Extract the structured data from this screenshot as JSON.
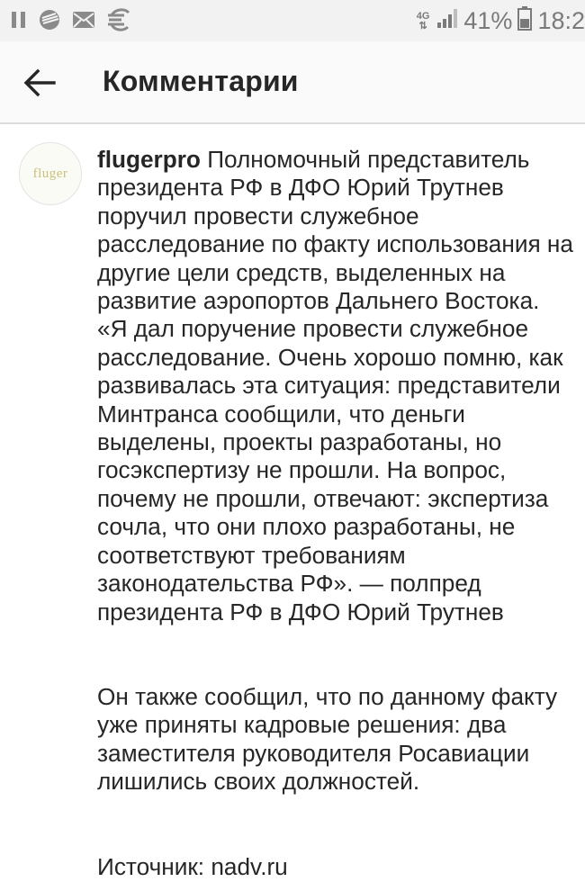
{
  "status_bar": {
    "network_type": "4G",
    "battery_percent": "41%",
    "time": "18:2"
  },
  "header": {
    "title": "Комментарии"
  },
  "comment": {
    "avatar_text": "fluger",
    "username": "flugerpro",
    "paragraph_1": "Полномочный представитель президента РФ в ДФО Юрий Трутнев поручил провести служебное расследование по факту использования на другие цели средств, выделенных на развитие аэропортов Дальнего Востока. «Я дал поручение провести служебное расследование. Очень хорошо помню, как развивалась эта ситуация: представители Минтранса сообщили, что деньги выделены, проекты разработаны, но госэкспертизу не прошли. На вопрос, почему не прошли, отвечают: экспертиза сочла, что они плохо разработаны, не соответствуют требованиям законодательства РФ». — полпред президента РФ в ДФО Юрий Трутнев",
    "paragraph_2": "Он также сообщил, что по данному факту уже приняты кадровые решения: два заместителя руководителя Росавиации лишились своих должностей.",
    "source": "Источник: nadv.ru"
  },
  "icons": {
    "status_left": [
      "pause-icon",
      "sberbank-icon",
      "mail-icon",
      "euro-app-icon"
    ],
    "status_right": [
      "signal-icon",
      "battery-icon"
    ],
    "header": "arrow-back-icon"
  }
}
